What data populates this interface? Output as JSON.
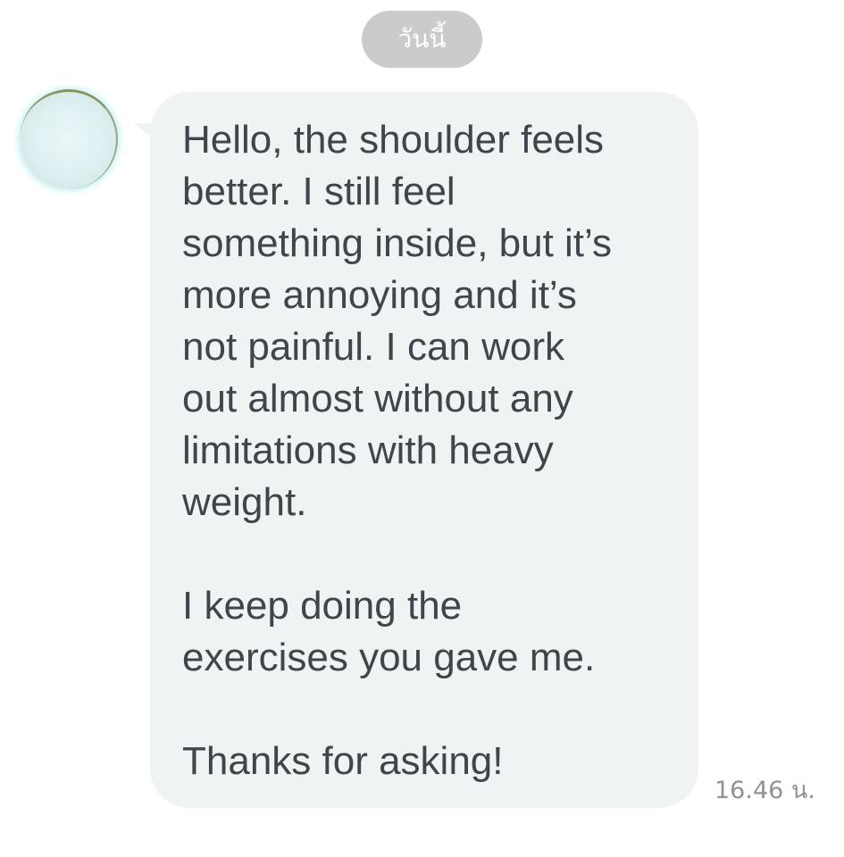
{
  "chat": {
    "date_separator": "วันนี้",
    "message": {
      "sender_avatar_icon": "contact-avatar",
      "text": "Hello, the shoulder feels\nbetter. I still feel\nsomething inside, but it’s\nmore annoying and it’s\nnot painful. I can work\nout almost without any\nlimitations with heavy\nweight.\n\nI keep doing the\nexercises you gave me.\n\nThanks for asking!",
      "timestamp": "16.46 น."
    }
  },
  "colors": {
    "background": "#ffffff",
    "bubble": "#f0f3f4",
    "date_pill": "#c9cbcc",
    "text": "#3f454b",
    "timestamp": "#8e9296"
  }
}
